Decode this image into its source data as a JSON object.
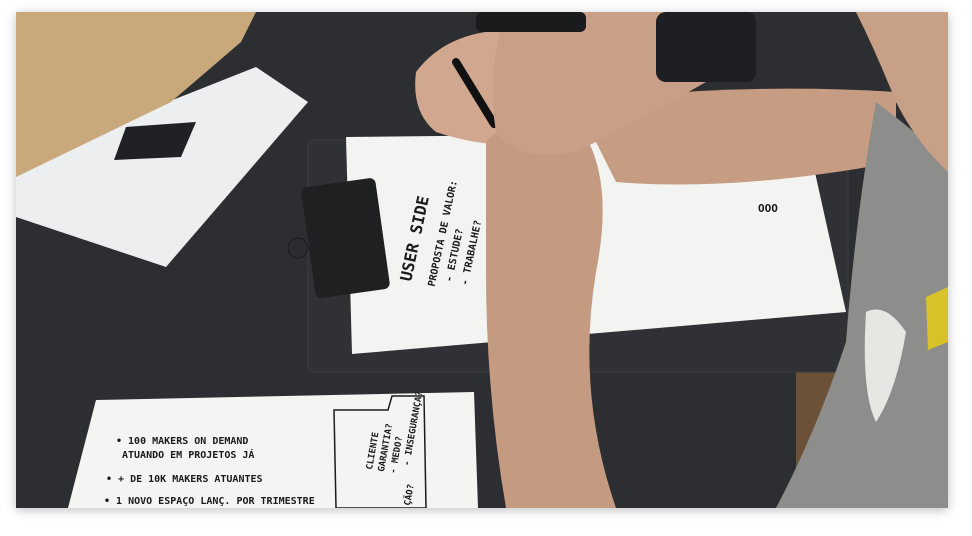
{
  "photo": {
    "subject": "person writing notes on a clipboard at a desk",
    "colors": {
      "desk": "#2b2d30",
      "paper": "#f3f3f1",
      "clipboard": "#2f3134",
      "skin": "#c9a188",
      "shirt": "#8e8e8c",
      "envelope": "#c8a87a"
    }
  },
  "clipboard_sheet": {
    "title": "USER SIDE",
    "line1": "PROPOSTA DE VALOR:",
    "line2": "- ESTUDE?",
    "line3": "- TRABALHE?",
    "corner_mark": "OOO"
  },
  "bottom_sheet": {
    "line1": "• 100 MAKERS ON DEMAND",
    "line2": "ATUANDO EM PROJETOS JÁ",
    "line3": "• + DE 10K MAKERS ATUANTES",
    "line4": "• 1 NOVO ESPAÇO LANÇ. POR TRIMESTRE",
    "box_line1": "CLIENTE",
    "box_line2": "GARANTIA?",
    "box_line3": "- MEDO?",
    "box_line4": "- INSEGURANÇA?",
    "box_line5": "ÇÃO?"
  }
}
